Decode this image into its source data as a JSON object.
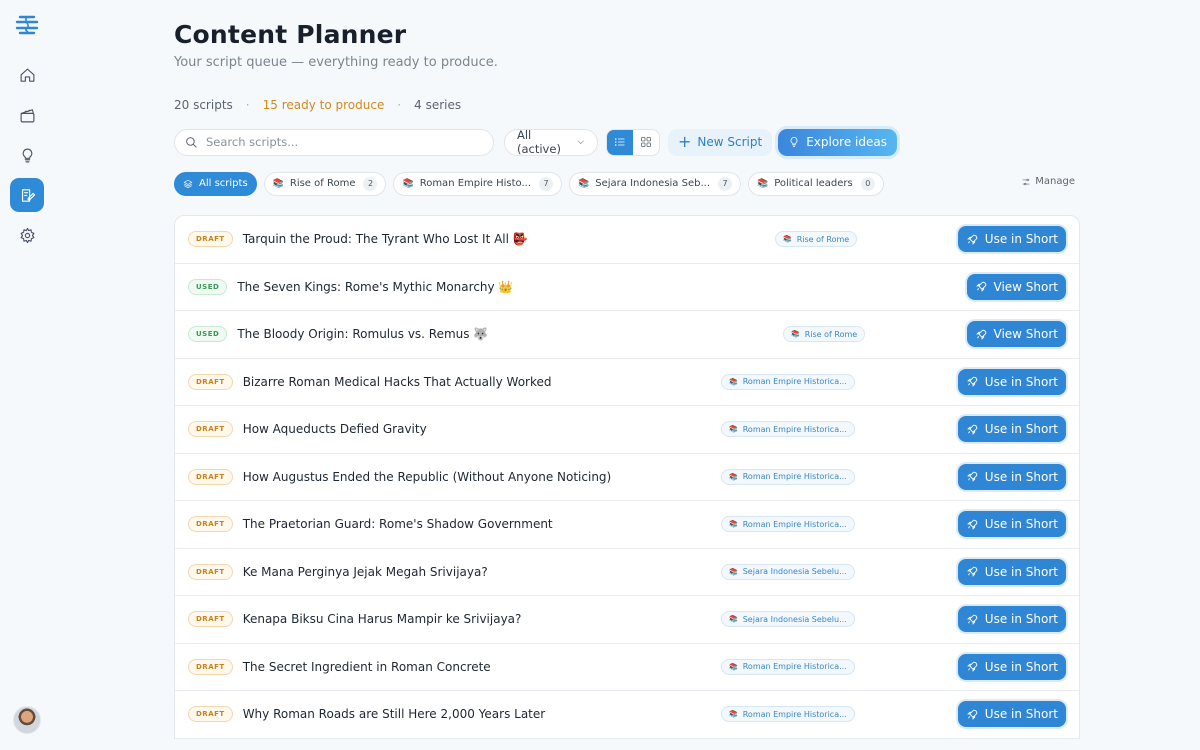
{
  "sidebar": {
    "items": [
      {
        "name": "home"
      },
      {
        "name": "clapperboard"
      },
      {
        "name": "lightbulb"
      },
      {
        "name": "scripts",
        "active": true
      },
      {
        "name": "settings"
      }
    ]
  },
  "header": {
    "title": "Content Planner",
    "subtitle": "Your script queue — everything ready to produce."
  },
  "stats": {
    "scripts": "20 scripts",
    "sep": "·",
    "ready": "15 ready to produce",
    "series": "4 series"
  },
  "toolbar": {
    "search_placeholder": "Search scripts...",
    "filter_value": "All (active)",
    "new_script_label": "New Script",
    "explore_label": "Explore ideas"
  },
  "filters": {
    "all_label": "All scripts",
    "chips": [
      {
        "label": "Rise of Rome",
        "count": "2"
      },
      {
        "label": "Roman Empire Histo...",
        "count": "7"
      },
      {
        "label": "Sejara Indonesia Seb...",
        "count": "7"
      },
      {
        "label": "Political leaders",
        "count": "0"
      }
    ],
    "manage_label": "Manage"
  },
  "rows": [
    {
      "status": "DRAFT",
      "title": "Tarquin the Proud: The Tyrant Who Lost It All 👺",
      "series": "Rise of Rome",
      "action": "Use in Short"
    },
    {
      "status": "USED",
      "title": "The Seven Kings: Rome's Mythic Monarchy 👑",
      "series": "",
      "action": "View Short"
    },
    {
      "status": "USED",
      "title": "The Bloody Origin: Romulus vs. Remus 🐺",
      "series": "Rise of Rome",
      "action": "View Short"
    },
    {
      "status": "DRAFT",
      "title": "Bizarre Roman Medical Hacks That Actually Worked",
      "series": "Roman Empire Historica...",
      "action": "Use in Short"
    },
    {
      "status": "DRAFT",
      "title": "How Aqueducts Defied Gravity",
      "series": "Roman Empire Historica...",
      "action": "Use in Short"
    },
    {
      "status": "DRAFT",
      "title": "How Augustus Ended the Republic (Without Anyone Noticing)",
      "series": "Roman Empire Historica...",
      "action": "Use in Short"
    },
    {
      "status": "DRAFT",
      "title": "The Praetorian Guard: Rome's Shadow Government",
      "series": "Roman Empire Historica...",
      "action": "Use in Short"
    },
    {
      "status": "DRAFT",
      "title": "Ke Mana Perginya Jejak Megah Srivijaya?",
      "series": "Sejara Indonesia Sebelu...",
      "action": "Use in Short"
    },
    {
      "status": "DRAFT",
      "title": "Kenapa Biksu Cina Harus Mampir ke Srivijaya?",
      "series": "Sejara Indonesia Sebelu...",
      "action": "Use in Short"
    },
    {
      "status": "DRAFT",
      "title": "The Secret Ingredient in Roman Concrete",
      "series": "Roman Empire Historica...",
      "action": "Use in Short"
    },
    {
      "status": "DRAFT",
      "title": "Why Roman Roads are Still Here 2,000 Years Later",
      "series": "Roman Empire Historica...",
      "action": "Use in Short"
    }
  ]
}
